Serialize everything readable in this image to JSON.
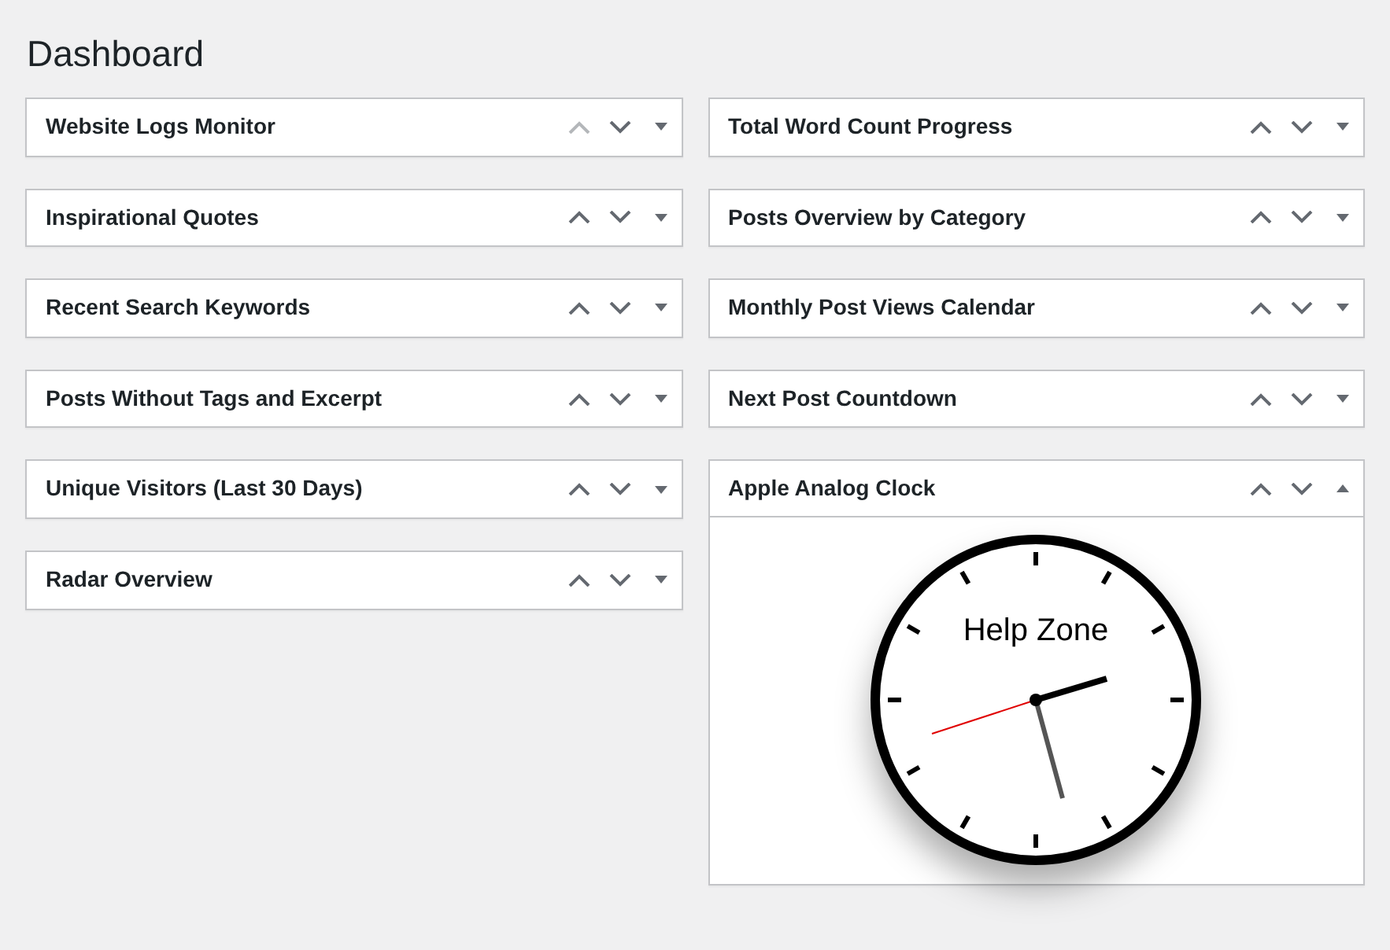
{
  "page": {
    "title": "Dashboard"
  },
  "columns": [
    {
      "widgets": [
        {
          "title": "Website Logs Monitor",
          "up_disabled": true,
          "expanded": false
        },
        {
          "title": "Inspirational Quotes",
          "up_disabled": false,
          "expanded": false
        },
        {
          "title": "Recent Search Keywords",
          "up_disabled": false,
          "expanded": false
        },
        {
          "title": "Posts Without Tags and Excerpt",
          "up_disabled": false,
          "expanded": false
        },
        {
          "title": "Unique Visitors (Last 30 Days)",
          "up_disabled": false,
          "expanded": false
        },
        {
          "title": "Radar Overview",
          "up_disabled": false,
          "expanded": false
        }
      ]
    },
    {
      "widgets": [
        {
          "title": "Total Word Count Progress",
          "up_disabled": false,
          "expanded": false
        },
        {
          "title": "Posts Overview by Category",
          "up_disabled": false,
          "expanded": false
        },
        {
          "title": "Monthly Post Views Calendar",
          "up_disabled": false,
          "expanded": false
        },
        {
          "title": "Next Post Countdown",
          "up_disabled": false,
          "expanded": false
        },
        {
          "title": "Apple Analog Clock",
          "up_disabled": false,
          "expanded": true,
          "clock": {
            "label": "Help Zone"
          }
        }
      ]
    }
  ]
}
